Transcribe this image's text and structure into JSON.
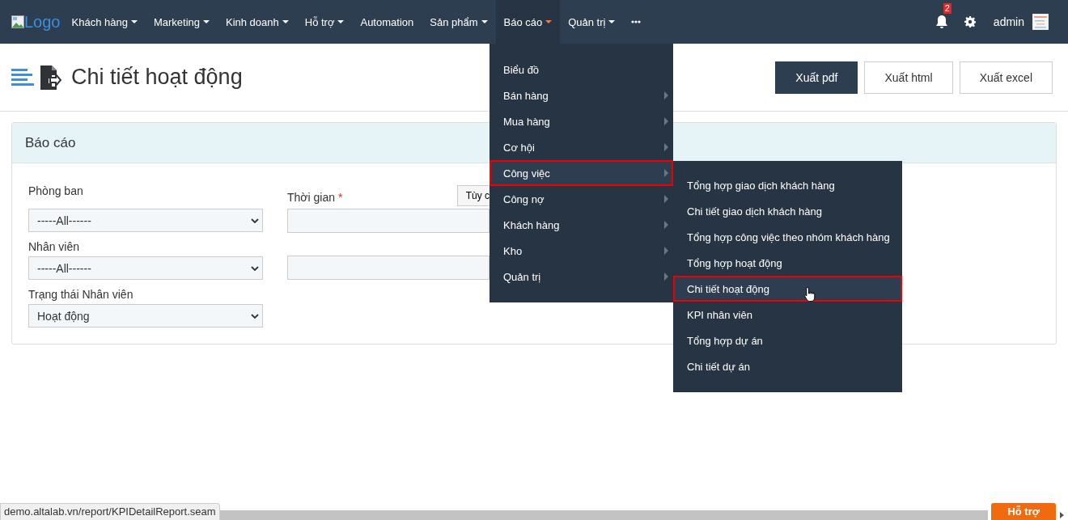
{
  "navbar": {
    "logo": "Logo",
    "items": [
      {
        "label": "Khách hàng",
        "dropdown": true,
        "selected": false
      },
      {
        "label": "Marketing",
        "dropdown": true,
        "selected": false
      },
      {
        "label": "Kinh doanh",
        "dropdown": true,
        "selected": false
      },
      {
        "label": "Hỗ trợ",
        "dropdown": true,
        "selected": false
      },
      {
        "label": "Automation",
        "dropdown": false,
        "selected": false
      },
      {
        "label": "Sản phẩm",
        "dropdown": true,
        "selected": false
      },
      {
        "label": "Báo cáo",
        "dropdown": true,
        "selected": true
      },
      {
        "label": "Quản trị",
        "dropdown": true,
        "selected": false
      }
    ],
    "notification_count": "2",
    "user": "admin"
  },
  "page": {
    "title": "Chi tiết hoạt động",
    "buttons": [
      {
        "label": "Xuất pdf",
        "kind": "primary"
      },
      {
        "label": "Xuất html",
        "kind": "default"
      },
      {
        "label": "Xuất excel",
        "kind": "default"
      }
    ]
  },
  "panel": {
    "title": "Báo cáo",
    "left_fields": [
      {
        "label": "Phòng ban",
        "value": "-----All------"
      },
      {
        "label": "Nhân viên",
        "value": "-----All------"
      },
      {
        "label": "Trạng thái Nhân viên",
        "value": "Hoạt động"
      }
    ],
    "time_label": "Thời gian",
    "required_mark": "*",
    "time_button": "Tùy c"
  },
  "menu": {
    "items": [
      {
        "label": "Biểu đồ",
        "submenu": false,
        "selected": false
      },
      {
        "label": "Bán hàng",
        "submenu": true,
        "selected": false
      },
      {
        "label": "Mua hàng",
        "submenu": true,
        "selected": false
      },
      {
        "label": "Cơ hội",
        "submenu": true,
        "selected": false
      },
      {
        "label": "Công việc",
        "submenu": true,
        "selected": true
      },
      {
        "label": "Công nợ",
        "submenu": true,
        "selected": false
      },
      {
        "label": "Khách hàng",
        "submenu": true,
        "selected": false
      },
      {
        "label": "Kho",
        "submenu": true,
        "selected": false
      },
      {
        "label": "Quản trị",
        "submenu": true,
        "selected": false
      }
    ],
    "submenu": [
      {
        "label": "Tổng hợp giao dịch khách hàng",
        "selected": false
      },
      {
        "label": "Chi tiết giao dịch khách hàng",
        "selected": false
      },
      {
        "label": "Tổng hợp công việc theo nhóm khách hàng",
        "selected": false
      },
      {
        "label": "Tổng hợp hoạt động",
        "selected": false
      },
      {
        "label": "Chi tiết hoạt động",
        "selected": true
      },
      {
        "label": "KPI nhân viên",
        "selected": false
      },
      {
        "label": "Tổng hợp dự án",
        "selected": false
      },
      {
        "label": "Chi tiết dự án",
        "selected": false
      }
    ]
  },
  "status_url": "demo.altalab.vn/report/KPIDetailReport.seam",
  "help_button": "Hỗ trợ"
}
